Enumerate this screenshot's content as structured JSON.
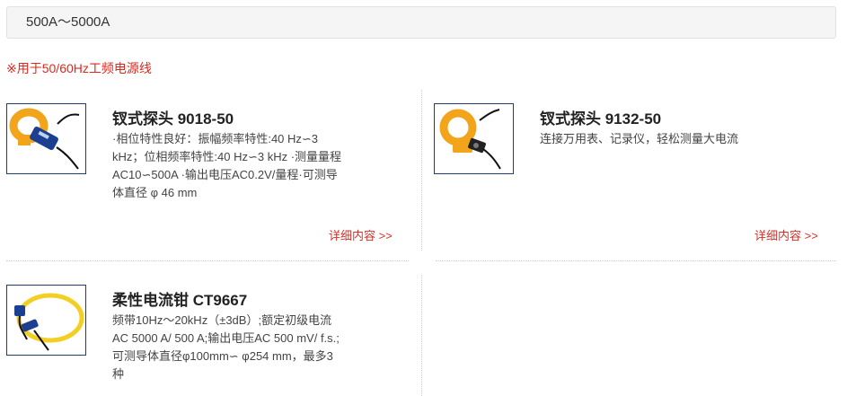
{
  "range_filter": {
    "label": "500A～5000A"
  },
  "note": "※用于50/60Hz工频电源线",
  "products": [
    {
      "title": "钗式探头 9018-50",
      "description": "·相位特性良好：振幅频率特性:40 Hz∽3 kHz；位相频率特性:40 Hz∽3 kHz ·测量量程AC10∽500A ·输出电压AC0.2V/量程·可测导体直径 φ 46 mm",
      "more_label": "详细内容 >>"
    },
    {
      "title": "钗式探头 9132-50",
      "description": "连接万用表、记录仪，轻松测量大电流",
      "more_label": "详细内容 >>"
    },
    {
      "title": "柔性电流钳 CT9667",
      "description": "频带10Hz～20kHz（±3dB）;额定初级电流AC 5000 A/ 500 A;输出电压AC 500 mV/ f.s.;可测导体直径φ100mm∽ φ254 mm，最多3种"
    }
  ],
  "colors": {
    "note_red": "#e0281d",
    "link_red": "#d0342c",
    "thumb_border": "#1f3d70",
    "clamp_yellow": "#f2a51a"
  }
}
